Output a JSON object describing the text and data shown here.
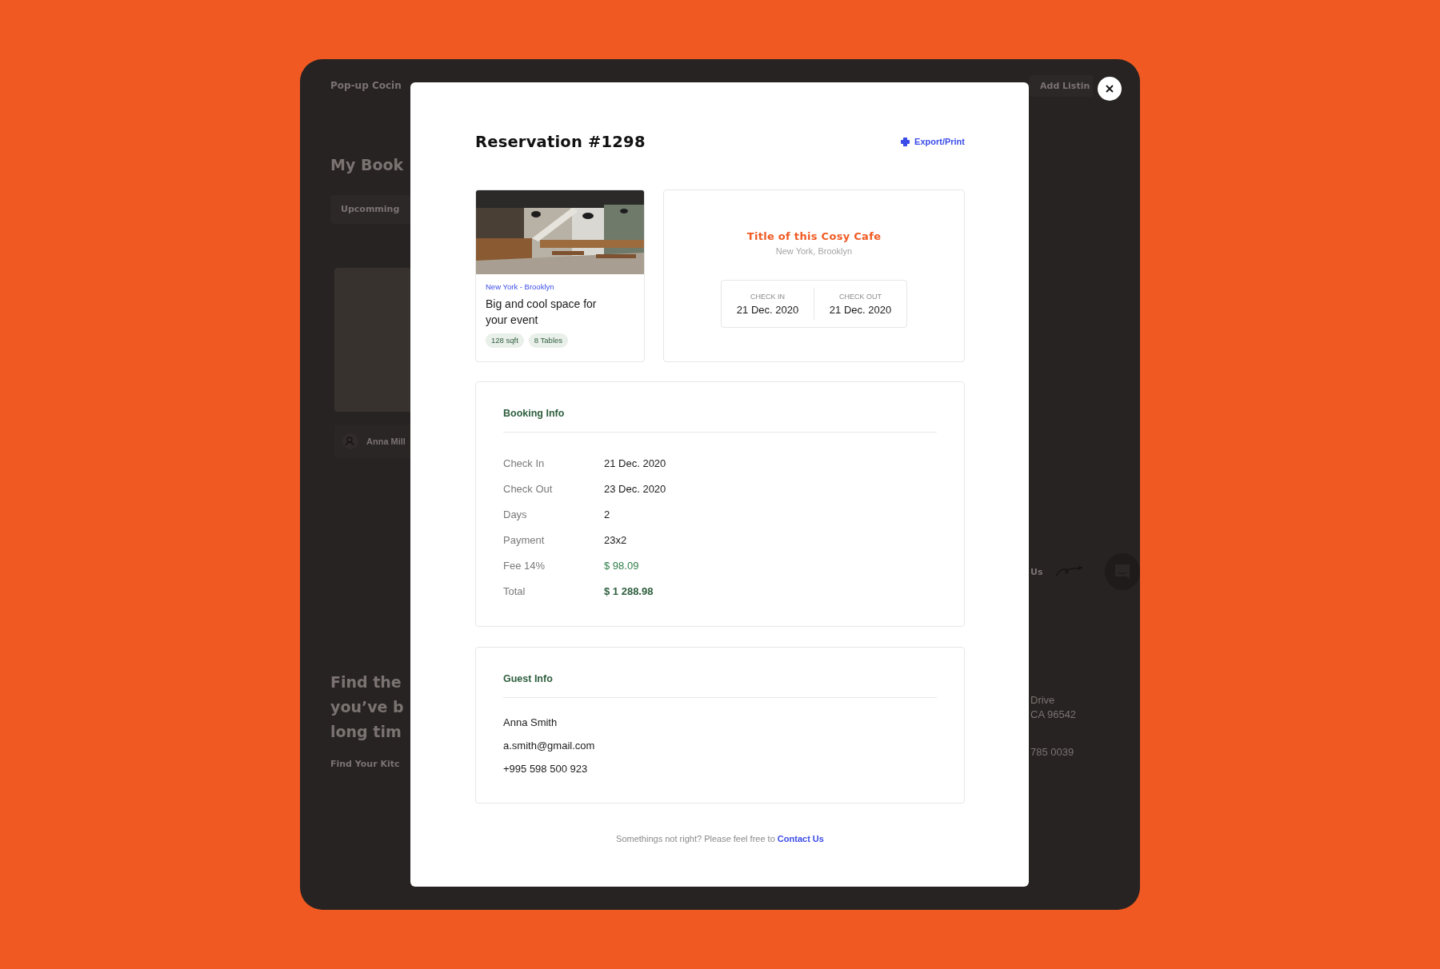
{
  "background": {
    "brand": "Pop-up Cocin",
    "heading": "My Book",
    "tab": "Upcomming",
    "host_name": "Anna Mill",
    "promo_lines": [
      "Find the",
      "you’ve b",
      "long tim"
    ],
    "promo_link": "Find Your Kitc",
    "add_button": "Add Listin",
    "contact_label": "Us",
    "address_lines": [
      "Drive",
      "CA 96542"
    ],
    "phone": "785 0039"
  },
  "modal": {
    "title": "Reservation #1298",
    "export": "Export/Print"
  },
  "listing": {
    "location": "New York - Brooklyn",
    "title": "Big and cool space for your event",
    "tags": [
      "128 sqft",
      "8 Tables"
    ]
  },
  "venue": {
    "title": "Title of this Cosy Cafe",
    "subtitle": "New York, Brooklyn",
    "dates": [
      {
        "label": "CHECK IN",
        "value": "21 Dec. 2020"
      },
      {
        "label": "CHECK OUT",
        "value": "21 Dec. 2020"
      }
    ]
  },
  "booking_info": {
    "title": "Booking Info",
    "rows": [
      {
        "label": "Check In",
        "value": "21 Dec. 2020",
        "kind": "plain"
      },
      {
        "label": "Check Out",
        "value": "23 Dec. 2020",
        "kind": "plain"
      },
      {
        "label": "Days",
        "value": "2",
        "kind": "plain"
      },
      {
        "label": "Payment",
        "value": "23x2",
        "kind": "plain"
      },
      {
        "label": "Fee 14%",
        "value": "$ 98.09",
        "kind": "fee"
      },
      {
        "label": "Total",
        "value": "$ 1 288.98",
        "kind": "total"
      }
    ]
  },
  "guest_info": {
    "title": "Guest Info",
    "lines": [
      "Anna Smith",
      "a.smith@gmail.com",
      "+995 598 500 923"
    ]
  },
  "footer": {
    "text": "Somethings not right? Please feel free to",
    "link": "Contact Us"
  }
}
